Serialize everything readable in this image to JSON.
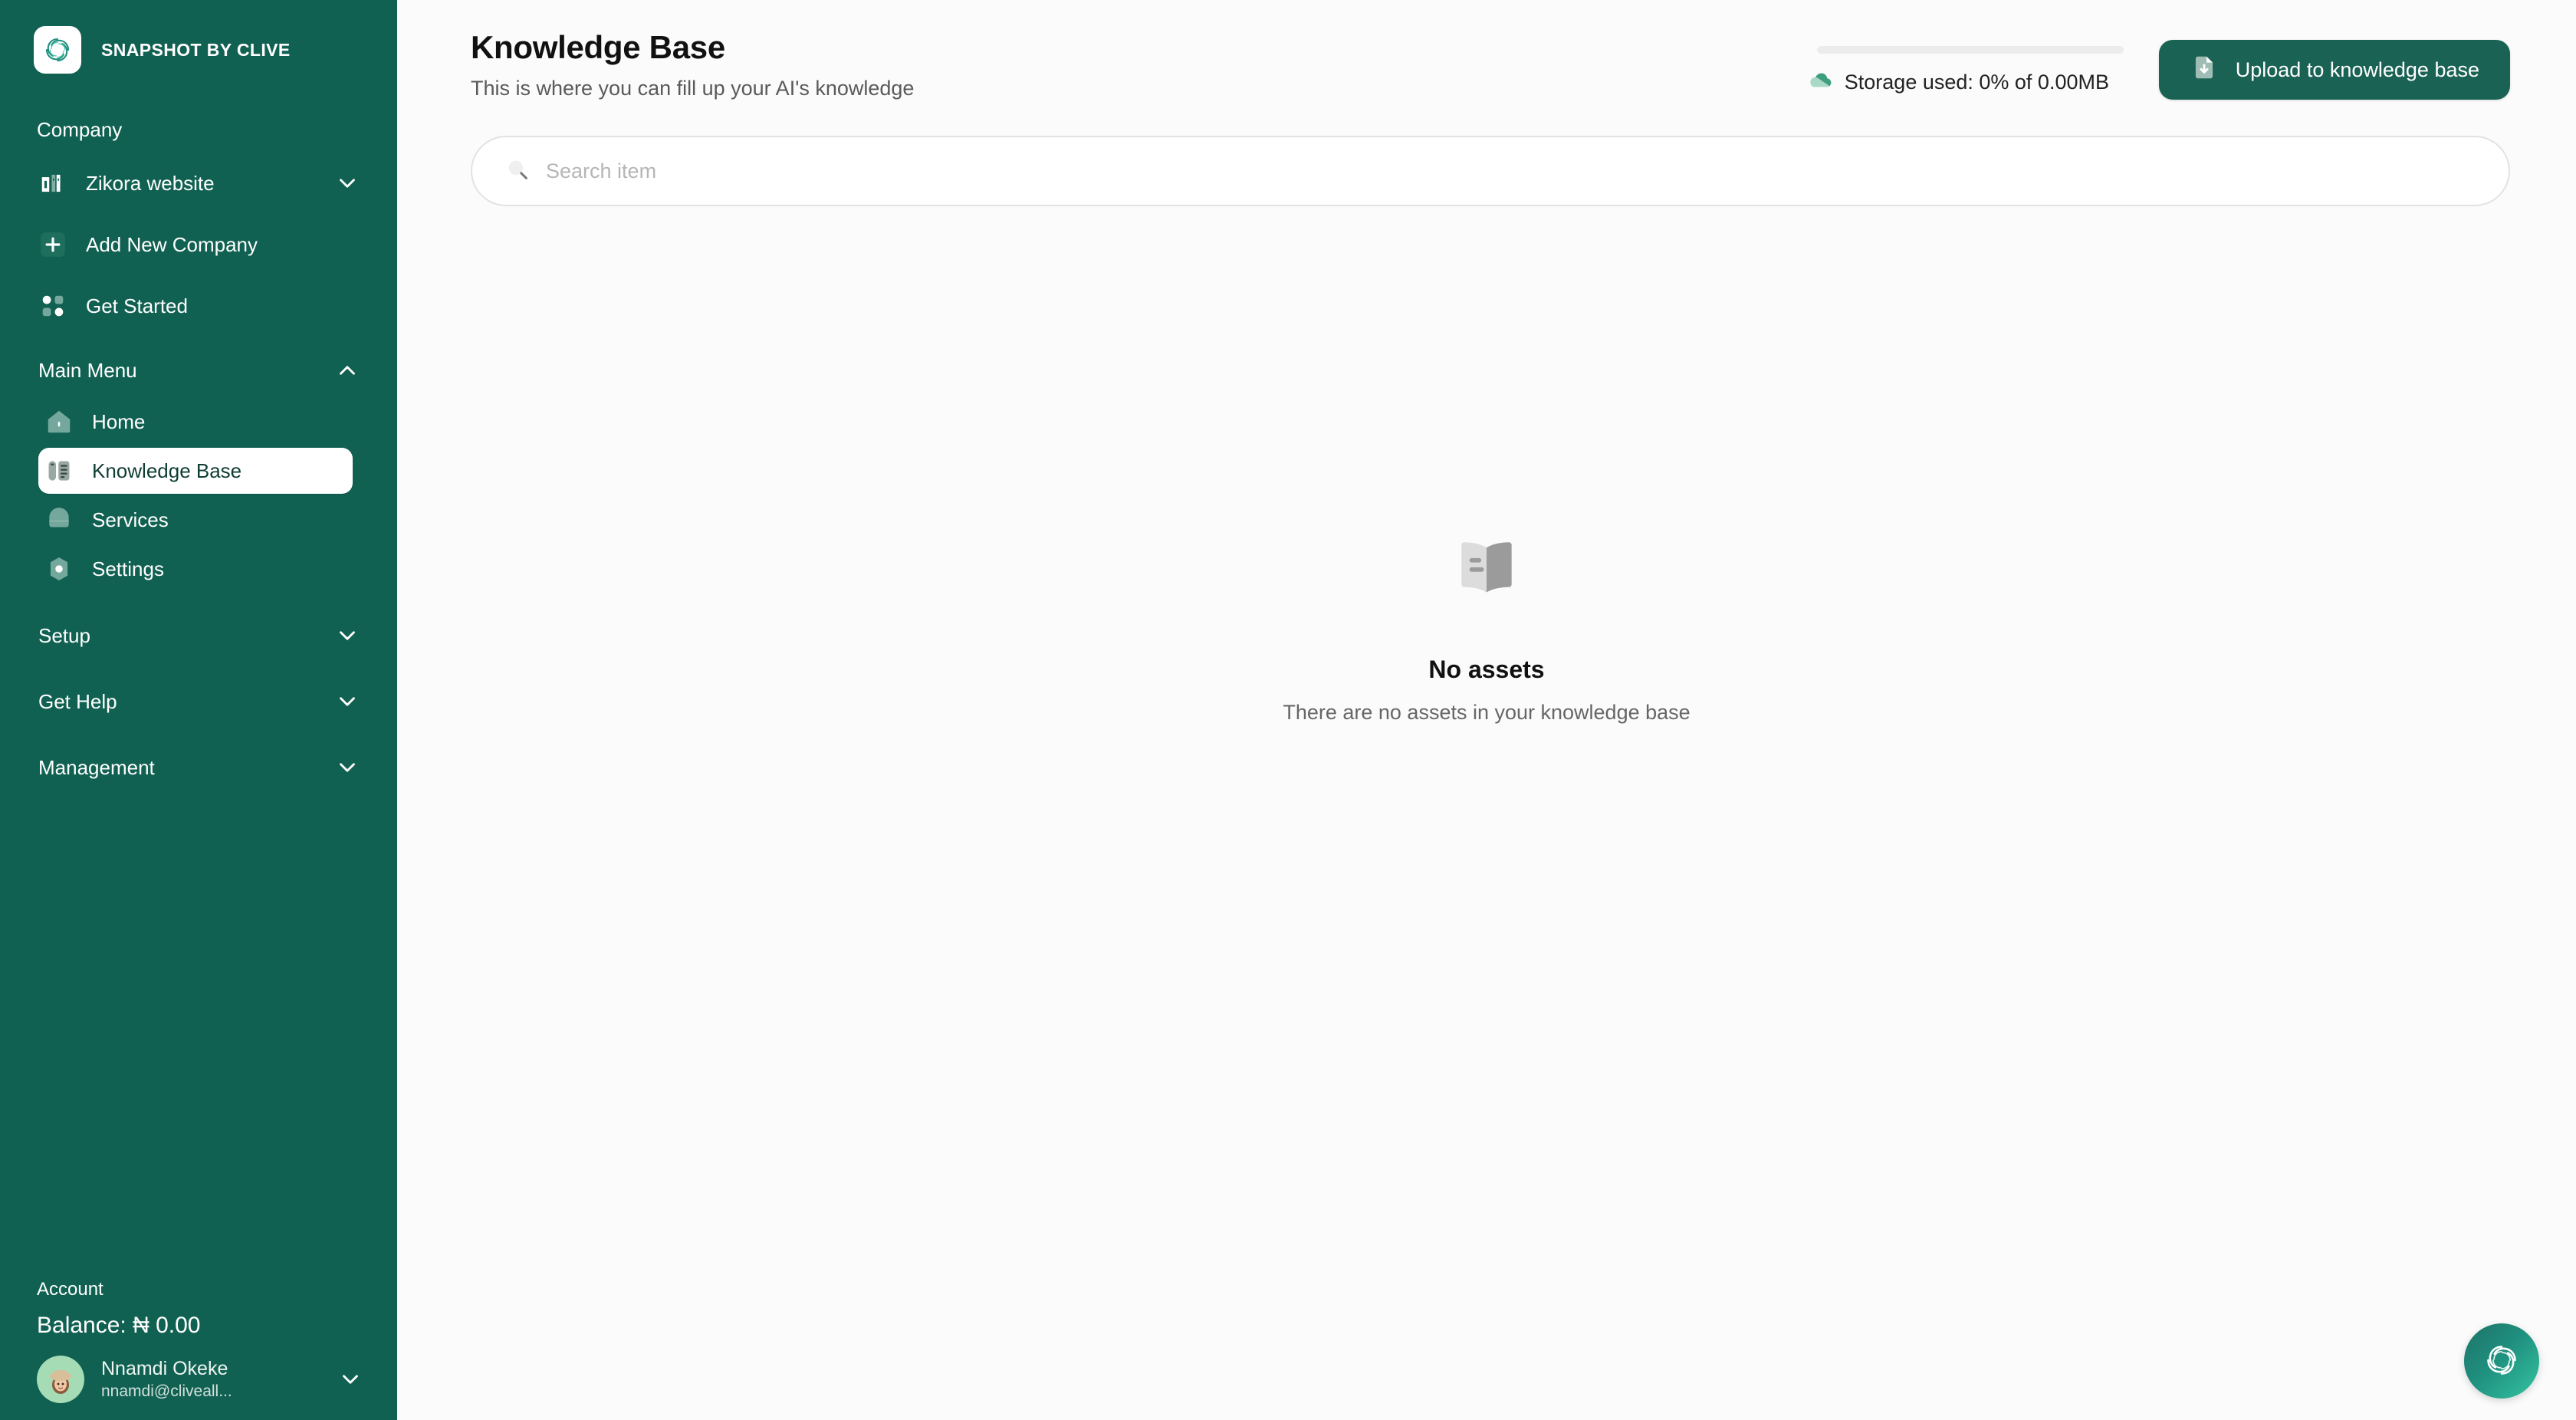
{
  "brand": {
    "name": "SNAPSHOT BY CLIVE",
    "logo_icon": "swirl-logo-icon"
  },
  "sidebar": {
    "company_section": {
      "label": "Company",
      "items": [
        {
          "label": "Zikora website",
          "icon": "company-building-icon",
          "trailing_icon": "chevron-down-icon"
        },
        {
          "label": "Add New Company",
          "icon": "plus-icon"
        },
        {
          "label": "Get Started",
          "icon": "grid-dots-icon"
        }
      ]
    },
    "main_menu": {
      "label": "Main Menu",
      "trailing_icon": "chevron-up-icon",
      "items": [
        {
          "label": "Home",
          "icon": "home-icon",
          "active": false
        },
        {
          "label": "Knowledge Base",
          "icon": "knowledge-base-icon",
          "active": true
        },
        {
          "label": "Services",
          "icon": "services-icon",
          "active": false
        },
        {
          "label": "Settings",
          "icon": "settings-icon",
          "active": false
        }
      ]
    },
    "groups": [
      {
        "label": "Setup",
        "trailing_icon": "chevron-down-icon"
      },
      {
        "label": "Get Help",
        "trailing_icon": "chevron-down-icon"
      },
      {
        "label": "Management",
        "trailing_icon": "chevron-down-icon"
      }
    ],
    "account": {
      "title": "Account",
      "balance": "Balance: ₦ 0.00",
      "user_name": "Nnamdi Okeke",
      "user_email": "nnamdi@cliveall...",
      "trailing_icon": "chevron-down-icon",
      "avatar_icon": "user-avatar"
    }
  },
  "header": {
    "title": "Knowledge Base",
    "subtitle": "This is where you can fill up your AI's knowledge"
  },
  "storage": {
    "text": "Storage used: 0% of 0.00MB",
    "percent": 0,
    "icon": "cloud-icon"
  },
  "upload": {
    "label": "Upload to knowledge base",
    "icon": "file-upload-icon"
  },
  "search": {
    "placeholder": "Search item",
    "value": "",
    "icon": "search-icon"
  },
  "empty_state": {
    "icon": "open-book-icon",
    "title": "No assets",
    "subtitle": "There are no assets in your knowledge base"
  },
  "fab": {
    "icon": "swirl-logo-icon"
  },
  "colors": {
    "sidebar_bg": "#116152",
    "main_bg": "#FBFBFB",
    "accent": "#1A6354",
    "active_item_bg": "#FFFFFF",
    "fab_gradient_start": "#1E7268",
    "fab_gradient_end": "#35C4A2"
  }
}
